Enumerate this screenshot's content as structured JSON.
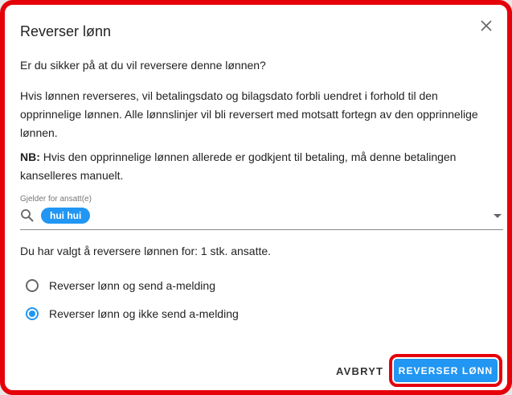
{
  "dialog": {
    "title": "Reverser lønn",
    "question": "Er du sikker på at du vil reversere denne lønnen?",
    "info": "Hvis lønnen reverseres, vil betalingsdato og bilagsdato forbli uendret i forhold til den opprinnelige lønnen. Alle lønnslinjer vil bli reversert med motsatt fortegn av den opprinnelige lønnen.",
    "note_label": "NB:",
    "note_text": " Hvis den opprinnelige lønnen allerede er godkjent til betaling, må denne betalingen kanselleres manuelt."
  },
  "employee_field": {
    "label": "Gjelder for ansatt(e)",
    "chip": "hui hui"
  },
  "summary": "Du har valgt å reversere lønnen for: 1 stk. ansatte.",
  "options": [
    {
      "label": "Reverser lønn og send a-melding",
      "checked": false
    },
    {
      "label": "Reverser lønn og ikke send a-melding",
      "checked": true
    }
  ],
  "actions": {
    "cancel": "AVBRYT",
    "confirm": "REVERSER LØNN"
  },
  "colors": {
    "accent": "#2196f3",
    "highlight_border": "#e5000a"
  }
}
